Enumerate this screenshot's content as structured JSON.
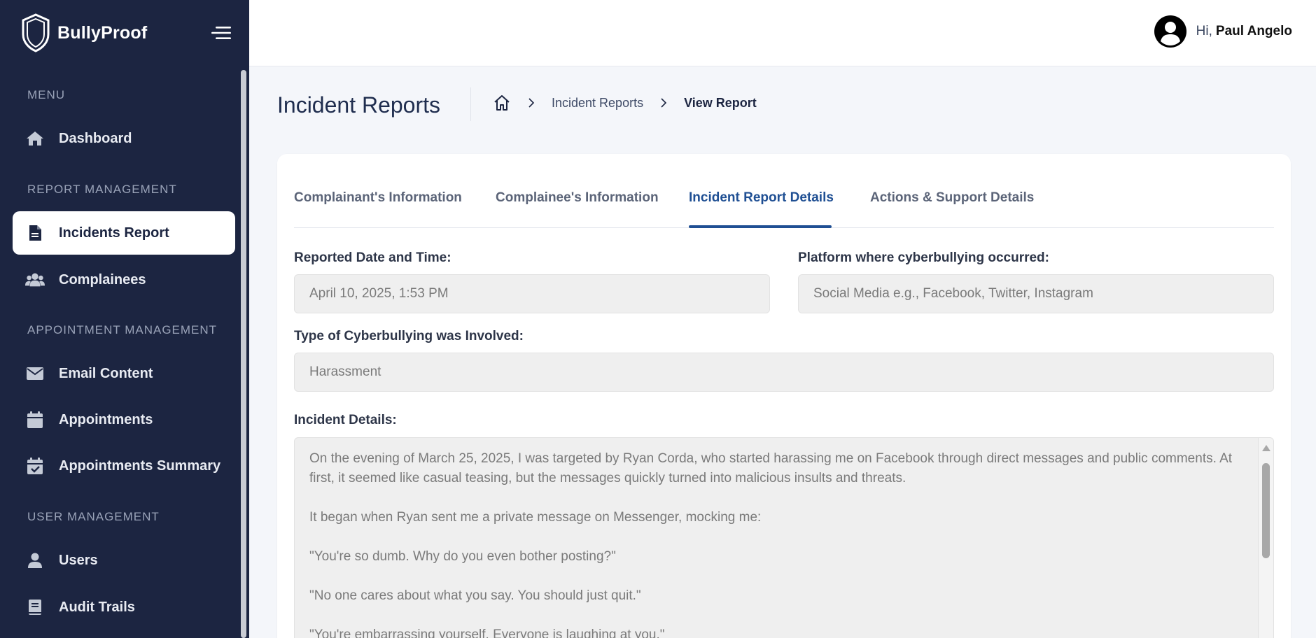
{
  "brand": {
    "name": "BullyProof"
  },
  "sidebar": {
    "sections": [
      {
        "label": "MENU"
      },
      {
        "label": "REPORT MANAGEMENT"
      },
      {
        "label": "APPOINTMENT MANAGEMENT"
      },
      {
        "label": "USER MANAGEMENT"
      }
    ],
    "items": [
      {
        "label": "Dashboard",
        "icon": "home-icon"
      },
      {
        "label": "Incidents Report",
        "icon": "document-icon",
        "active": true
      },
      {
        "label": "Complainees",
        "icon": "users-icon"
      },
      {
        "label": "Email Content",
        "icon": "envelope-icon"
      },
      {
        "label": "Appointments",
        "icon": "calendar-icon"
      },
      {
        "label": "Appointments Summary",
        "icon": "calendar-check-icon"
      },
      {
        "label": "Users",
        "icon": "user-icon"
      },
      {
        "label": "Audit Trails",
        "icon": "book-icon"
      }
    ]
  },
  "topbar": {
    "greeting": "Hi,",
    "user_name": "Paul Angelo"
  },
  "page": {
    "title": "Incident Reports",
    "breadcrumb": {
      "link": "Incident Reports",
      "current": "View Report"
    }
  },
  "tabs": [
    {
      "label": "Complainant's Information"
    },
    {
      "label": "Complainee's Information"
    },
    {
      "label": "Incident Report Details",
      "active": true
    },
    {
      "label": "Actions & Support Details"
    }
  ],
  "form": {
    "reported_datetime": {
      "label": "Reported Date and Time:",
      "value": "April 10, 2025, 1:53 PM"
    },
    "platform": {
      "label": "Platform where cyberbullying occurred:",
      "placeholder": "Social Media e.g., Facebook, Twitter, Instagram"
    },
    "type": {
      "label": "Type of Cyberbullying was Involved:",
      "value": "Harassment"
    },
    "details": {
      "label": "Incident Details:",
      "paragraphs": [
        "On the evening of March 25, 2025, I was targeted by Ryan Corda, who started harassing me on Facebook through direct messages and public comments. At first, it seemed like casual teasing, but the messages quickly turned into malicious insults and threats.",
        "It began when Ryan sent me a private message on Messenger, mocking me:",
        "\"You're so dumb. Why do you even bother posting?\"",
        "\"No one cares about what you say. You should just quit.\"",
        "\"You're embarrassing yourself. Everyone is laughing at you.\""
      ]
    }
  },
  "colors": {
    "sidebar_bg": "#1c2541",
    "accent": "#1f4f93",
    "page_bg": "#f4f6fa"
  }
}
